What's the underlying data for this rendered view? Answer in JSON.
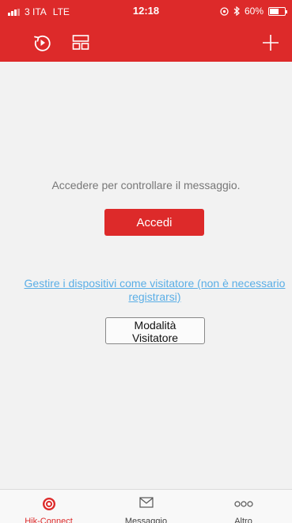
{
  "status_bar": {
    "carrier": "3 ITA",
    "network": "LTE",
    "time": "12:18",
    "battery": "60%",
    "battery_level": 0.6
  },
  "toolbar": {
    "history_icon": "history-icon",
    "layout_icon": "layout-icon",
    "add_icon": "plus-icon"
  },
  "main": {
    "prompt": "Accedere per controllare il messaggio.",
    "login_label": "Accedi",
    "visitor_link_line1": "Gestire i dispositivi come visitatore (non è necessario",
    "visitor_link_line2": "registrarsi)",
    "visitor_button_label": "Modalità Visitatore"
  },
  "tabs": [
    {
      "label": "Hik-Connect",
      "icon": "hik-connect-icon",
      "active": true
    },
    {
      "label": "Messaggio",
      "icon": "envelope-icon",
      "active": false
    },
    {
      "label": "Altro",
      "icon": "more-icon",
      "active": false
    }
  ],
  "colors": {
    "brand": "#dd2a2a",
    "link": "#5aaee6",
    "background": "#f2f2f2"
  }
}
